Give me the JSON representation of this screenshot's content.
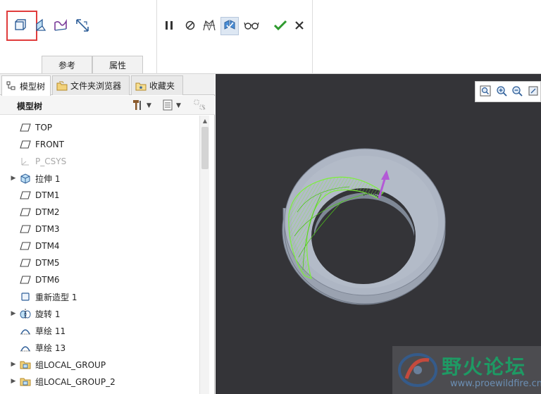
{
  "ribbon": {
    "tools_left": [
      {
        "name": "solid-surface-icon",
        "interactable": true
      },
      {
        "name": "surface-icon",
        "interactable": true
      },
      {
        "name": "thin-icon",
        "interactable": true
      },
      {
        "name": "remove-material-icon",
        "interactable": true
      }
    ],
    "tools_right": [
      {
        "name": "pause-icon"
      },
      {
        "name": "no-preview-icon"
      },
      {
        "name": "detail-preview-icon"
      },
      {
        "name": "verify-mode-icon"
      },
      {
        "name": "glasses-preview-icon"
      },
      {
        "name": "ok-check-icon"
      },
      {
        "name": "cancel-x-icon"
      }
    ],
    "tabs": [
      {
        "label": "参考"
      },
      {
        "label": "属性"
      }
    ]
  },
  "navigator": {
    "tabs": [
      {
        "label": "模型树",
        "icon": "model-tree-icon"
      },
      {
        "label": "文件夹浏览器",
        "icon": "folder-browser-icon"
      },
      {
        "label": "收藏夹",
        "icon": "favorites-icon"
      }
    ],
    "tree_title": "模型树",
    "items": [
      {
        "label": "TOP",
        "icon": "datum-plane-icon",
        "expandable": false,
        "dim": false
      },
      {
        "label": "FRONT",
        "icon": "datum-plane-icon",
        "expandable": false,
        "dim": false
      },
      {
        "label": "P_CSYS",
        "icon": "csys-icon",
        "expandable": false,
        "dim": true
      },
      {
        "label": "拉伸 1",
        "icon": "extrude-icon",
        "expandable": true,
        "dim": false
      },
      {
        "label": "DTM1",
        "icon": "datum-plane-icon",
        "expandable": false,
        "dim": false
      },
      {
        "label": "DTM2",
        "icon": "datum-plane-icon",
        "expandable": false,
        "dim": false
      },
      {
        "label": "DTM3",
        "icon": "datum-plane-icon",
        "expandable": false,
        "dim": false
      },
      {
        "label": "DTM4",
        "icon": "datum-plane-icon",
        "expandable": false,
        "dim": false
      },
      {
        "label": "DTM5",
        "icon": "datum-plane-icon",
        "expandable": false,
        "dim": false
      },
      {
        "label": "DTM6",
        "icon": "datum-plane-icon",
        "expandable": false,
        "dim": false
      },
      {
        "label": "重新造型 1",
        "icon": "restyle-icon",
        "expandable": false,
        "dim": false
      },
      {
        "label": "旋转 1",
        "icon": "revolve-icon",
        "expandable": true,
        "dim": false
      },
      {
        "label": "草绘 11",
        "icon": "sketch-icon",
        "expandable": false,
        "dim": false
      },
      {
        "label": "草绘 13",
        "icon": "sketch-icon",
        "expandable": false,
        "dim": false
      },
      {
        "label": "组LOCAL_GROUP",
        "icon": "group-icon",
        "expandable": true,
        "dim": false
      },
      {
        "label": "组LOCAL_GROUP_2",
        "icon": "group-icon",
        "expandable": true,
        "dim": false
      }
    ]
  },
  "viewport": {
    "view_tools": [
      {
        "name": "refit-icon"
      },
      {
        "name": "zoom-in-icon"
      },
      {
        "name": "zoom-out-icon"
      },
      {
        "name": "repaint-icon"
      }
    ],
    "watermark": {
      "title": "野火论坛",
      "url": "www.proewildfire.cn"
    }
  },
  "colors": {
    "viewport_bg": "#343438",
    "highlight": "#e03c3c",
    "preview_mesh": "#7cf03a",
    "direction_arrow": "#b35ad6",
    "ok_green": "#2e9a2e",
    "part_gray": "#aab3c2"
  }
}
